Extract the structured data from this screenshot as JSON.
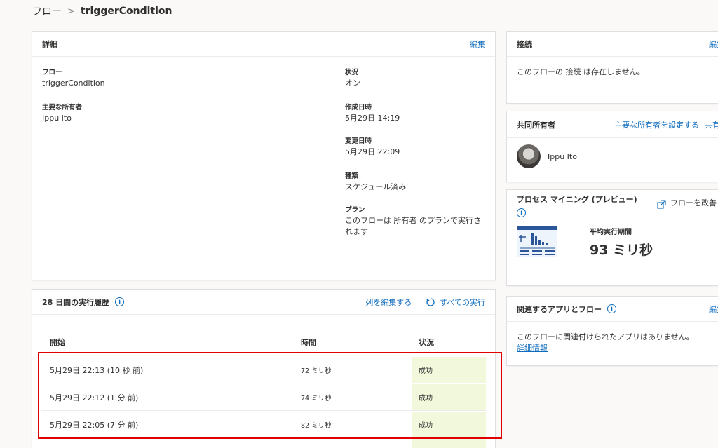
{
  "breadcrumb": {
    "root": "フロー",
    "separator": ">",
    "current": "triggerCondition"
  },
  "details": {
    "title": "詳細",
    "edit_label": "編集",
    "flow_label": "フロー",
    "flow_value": "triggerCondition",
    "owner_label": "主要な所有者",
    "owner_value": "Ippu Ito",
    "status_label": "状況",
    "status_value": "オン",
    "created_label": "作成日時",
    "created_value": "5月29日 14:19",
    "modified_label": "変更日時",
    "modified_value": "5月29日 22:09",
    "type_label": "種類",
    "type_value": "スケジュール済み",
    "plan_label": "プラン",
    "plan_value": "このフローは 所有者 のプランで実行されます"
  },
  "history": {
    "title": "28 日間の実行履歴",
    "edit_columns_label": "列を編集する",
    "all_runs_label": "すべての実行",
    "columns": {
      "start": "開始",
      "duration": "時間",
      "status": "状況"
    },
    "rows": [
      {
        "start": "5月29日 22:13 (10 秒 前)",
        "duration": "72 ミリ秒",
        "status": "成功"
      },
      {
        "start": "5月29日 22:12 (1 分 前)",
        "duration": "74 ミリ秒",
        "status": "成功"
      },
      {
        "start": "5月29日 22:05 (7 分 前)",
        "duration": "82 ミリ秒",
        "status": "成功"
      }
    ]
  },
  "connections": {
    "title": "接続",
    "edit_label": "編集",
    "message": "このフローの 接続 は存在しません。"
  },
  "coowners": {
    "title": "共同所有者",
    "set_owner_label": "主要な所有者を設定する",
    "share_label": "共有",
    "owner_name": "Ippu Ito"
  },
  "process_mining": {
    "title": "プロセス マイニング (プレビュー)",
    "improve_label": "フローを改善",
    "avg_label": "平均実行期間",
    "avg_value": "93 ミリ秒"
  },
  "related": {
    "title": "関連するアプリとフロー",
    "edit_label": "編集",
    "message": "このフローに関連付けられたアプリはありません。",
    "more_label": "詳細情報"
  },
  "colors": {
    "accent": "#0f6cbd",
    "success_bg": "#f1f8dc",
    "highlight": "#e00000"
  },
  "icons": [
    "info-icon",
    "refresh-icon",
    "open-external-icon",
    "process-chart-icon",
    "avatar"
  ]
}
